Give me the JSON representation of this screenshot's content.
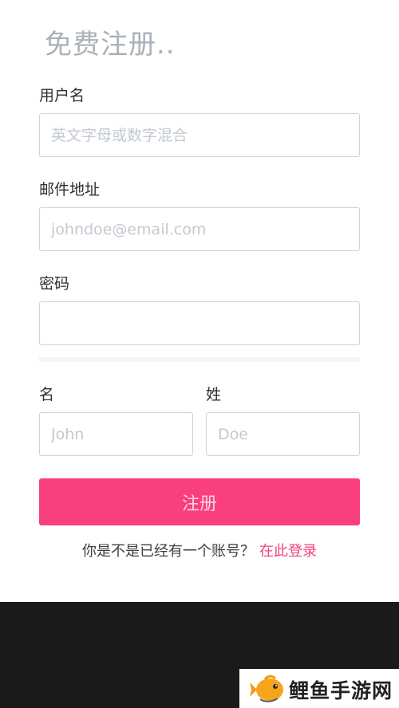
{
  "signup": {
    "title": "免费注册..",
    "username": {
      "label": "用户名",
      "placeholder": "英文字母或数字混合",
      "value": ""
    },
    "email": {
      "label": "邮件地址",
      "placeholder": "johndoe@email.com",
      "value": ""
    },
    "password": {
      "label": "密码",
      "placeholder": "",
      "value": ""
    },
    "first_name": {
      "label": "名",
      "placeholder": "John",
      "value": ""
    },
    "last_name": {
      "label": "姓",
      "placeholder": "Doe",
      "value": ""
    },
    "submit_label": "注册",
    "login_prompt": "你是不是已经有一个账号？",
    "login_link": "在此登录"
  },
  "watermark": {
    "text": "鲤鱼手游网",
    "logo_icon": "fish-icon"
  },
  "colors": {
    "accent": "#fa3f7e",
    "link": "#f0427e",
    "title": "#a9b1b9",
    "input_border": "#c9d4dc",
    "footer": "#1a1a1b"
  }
}
